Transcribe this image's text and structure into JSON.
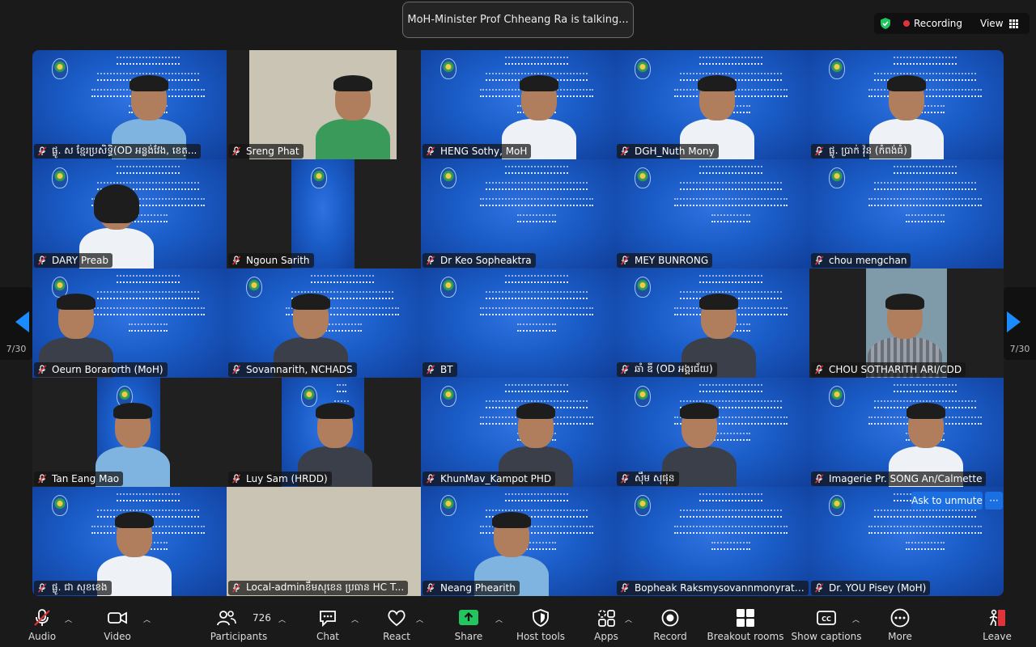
{
  "banner": {
    "speaking_text": "MoH-Minister Prof Chheang Ra is talking..."
  },
  "top_right": {
    "recording_label": "Recording",
    "view_label": "View",
    "security_icon": "shield-check-icon"
  },
  "pagination": {
    "left": "7/30",
    "right": "7/30"
  },
  "participants": [
    {
      "name": "ផ្លូ. ស ខ្មែរប្រសិទ្ធិ(OD អន្លង់វែង, ខេត្..."
    },
    {
      "name": "Sreng Phat"
    },
    {
      "name": "HENG Sothy, MoH"
    },
    {
      "name": "DGH_Nuth Mony"
    },
    {
      "name": "ផ្លូ. ប្រាក់ វ៉ុន (កំពង់ធំ)"
    },
    {
      "name": "DARY Preab"
    },
    {
      "name": "Ngoun Sarith"
    },
    {
      "name": "Dr Keo Sopheaktra"
    },
    {
      "name": "MEY BUNRONG"
    },
    {
      "name": "chou mengchan"
    },
    {
      "name": "Oeurn Borarorth (MoH)"
    },
    {
      "name": "Sovannarith, NCHADS"
    },
    {
      "name": "BT"
    },
    {
      "name": "ឆាំ ឌី (OD អង្គរជ័យ)"
    },
    {
      "name": "CHOU SOTHARITH  ARI/CDD"
    },
    {
      "name": "Tan Eang Mao"
    },
    {
      "name": "Luy Sam (HRDD)"
    },
    {
      "name": "KhunMav_Kampot PHD"
    },
    {
      "name": "ស៊ឹម សុផុន"
    },
    {
      "name": "Imagerie Pr. SONG An/Calmette"
    },
    {
      "name": "ផ្លូ. ជា សុខខេង"
    },
    {
      "name": "Local-adminខឹមសុខេន ប្រធាន HC T..."
    },
    {
      "name": "Neang Phearith"
    },
    {
      "name": "Bopheak Raksmysovannmonyrat_DGA"
    },
    {
      "name": "Dr. YOU Pisey (MoH)"
    }
  ],
  "ask_to_unmute": "Ask to unmute",
  "tile_more": "···",
  "toolbar": {
    "participants_count": "726",
    "items": [
      {
        "label": "Audio",
        "icon": "mic-off-icon"
      },
      {
        "label": "Video",
        "icon": "video-icon"
      },
      {
        "label": "Participants",
        "icon": "participants-icon"
      },
      {
        "label": "Chat",
        "icon": "chat-icon"
      },
      {
        "label": "React",
        "icon": "heart-icon"
      },
      {
        "label": "Share",
        "icon": "share-screen-icon"
      },
      {
        "label": "Host tools",
        "icon": "shield-icon"
      },
      {
        "label": "Apps",
        "icon": "apps-icon"
      },
      {
        "label": "Record",
        "icon": "record-icon"
      },
      {
        "label": "Breakout rooms",
        "icon": "breakout-rooms-icon"
      },
      {
        "label": "Show captions",
        "icon": "captions-icon"
      },
      {
        "label": "More",
        "icon": "more-icon"
      },
      {
        "label": "Leave",
        "icon": "leave-icon"
      }
    ]
  },
  "colors": {
    "accent": "#1a8cff",
    "share_green": "#22c55e",
    "leave_red": "#e0343a",
    "slide_blue": "#1a5cc7"
  }
}
